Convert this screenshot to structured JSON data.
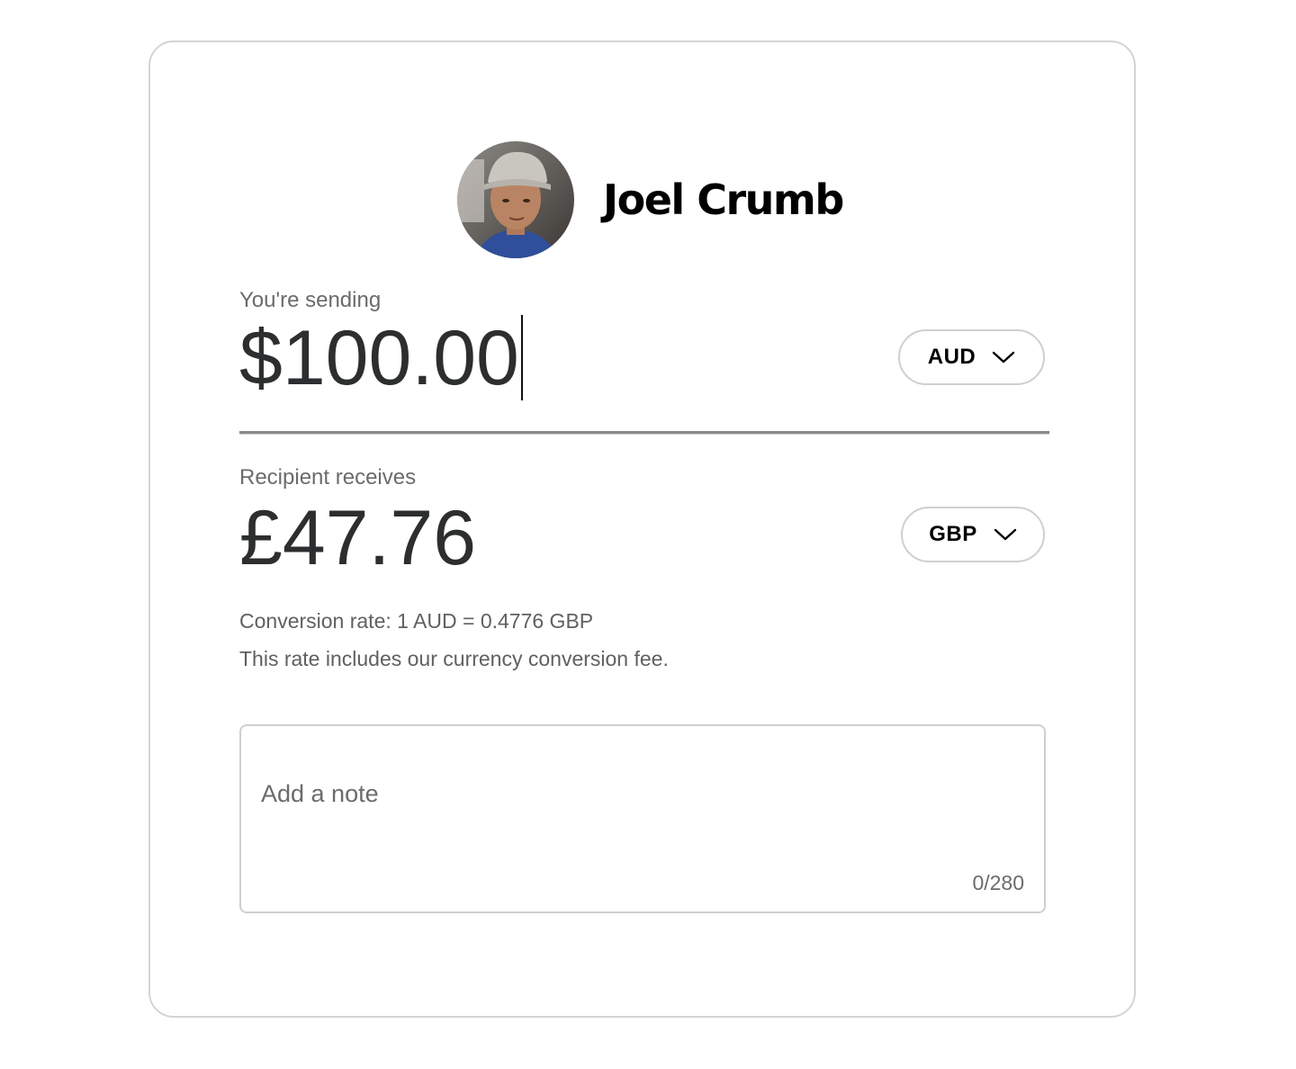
{
  "recipient": {
    "name": "Joel Crumb",
    "avatar_icon": "profile-photo"
  },
  "sending": {
    "label": "You're sending",
    "amount": "$100.00",
    "currency": "AUD",
    "chevron_icon": "chevron-down-icon"
  },
  "receiving": {
    "label": "Recipient receives",
    "amount": "£47.76",
    "currency": "GBP",
    "chevron_icon": "chevron-down-icon"
  },
  "conversion": {
    "rate_text": "Conversion rate: 1 AUD = 0.4776 GBP",
    "fee_text": "This rate includes our currency conversion fee."
  },
  "note": {
    "placeholder": "Add a note",
    "value": "",
    "counter": "0/280"
  },
  "colors": {
    "text_primary": "#2c2e2f",
    "text_secondary": "#6b6b6b",
    "border": "#cfcfcf"
  }
}
